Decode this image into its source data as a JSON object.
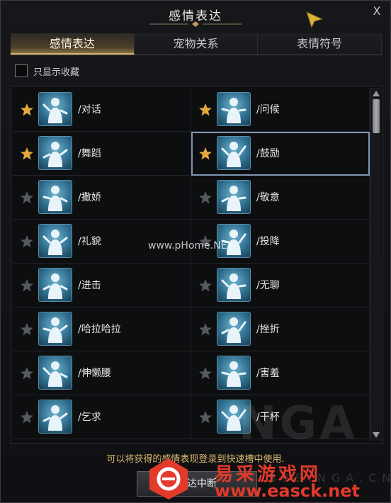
{
  "window": {
    "title": "感情表达",
    "close_label": "X"
  },
  "tabs": [
    {
      "label": "感情表达",
      "active": true
    },
    {
      "label": "宠物关系",
      "active": false
    },
    {
      "label": "表情符号",
      "active": false
    }
  ],
  "filter": {
    "label": "只显示收藏",
    "checked": false
  },
  "emotes": [
    {
      "name": "/对话",
      "favorite": true
    },
    {
      "name": "/问候",
      "favorite": true
    },
    {
      "name": "/舞蹈",
      "favorite": true
    },
    {
      "name": "/鼓励",
      "favorite": true,
      "selected": true
    },
    {
      "name": "/撒娇",
      "favorite": false
    },
    {
      "name": "/敬意",
      "favorite": false
    },
    {
      "name": "/礼貌",
      "favorite": false
    },
    {
      "name": "/投降",
      "favorite": false
    },
    {
      "name": "/进击",
      "favorite": false
    },
    {
      "name": "/无聊",
      "favorite": false
    },
    {
      "name": "/哈拉哈拉",
      "favorite": false
    },
    {
      "name": "/挫折",
      "favorite": false
    },
    {
      "name": "/伸懒腰",
      "favorite": false
    },
    {
      "name": "/害羞",
      "favorite": false
    },
    {
      "name": "/乞求",
      "favorite": false
    },
    {
      "name": "/干杯",
      "favorite": false
    }
  ],
  "hint_text": "可以将获得的感情表现登录到快速槽中使用.",
  "stop_button_label": "表达中断",
  "colors": {
    "accent_gold": "#d8b266",
    "star_active": "#e3a83c",
    "star_inactive": "#55585c",
    "selection": "#7f95b5"
  },
  "watermarks": {
    "phome": "www.pHome.NET",
    "nga": "NGA",
    "nga_sub": "BBS.NGA.CN",
    "site_cn": "易采游戏网",
    "site_url": "www.easck.net"
  }
}
